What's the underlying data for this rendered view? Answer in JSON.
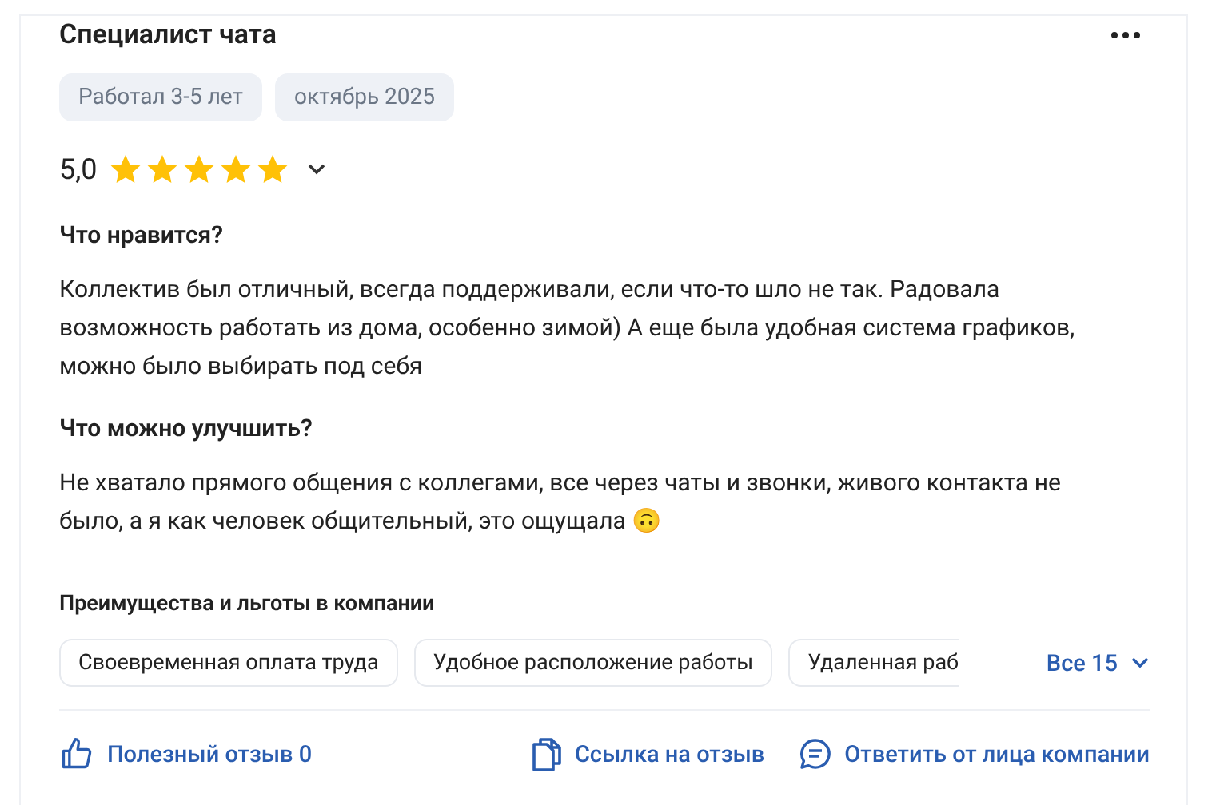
{
  "review": {
    "title": "Специалист чата",
    "tags": [
      "Работал 3-5 лет",
      "октябрь 2025"
    ],
    "rating": "5,0",
    "stars": 5,
    "sections": [
      {
        "heading": "Что нравится?",
        "text": "Коллектив был отличный, всегда поддерживали, если что-то шло не так. Радовала возможность работать из дома, особенно зимой) А еще была удобная система графиков, можно было выбирать под себя"
      },
      {
        "heading": "Что можно улучшить?",
        "text": "Не хватало прямого общения с коллегами, все через чаты и звонки, живого контакта не было, а я как человек общительный, это ощущала 🙃"
      }
    ],
    "benefits": {
      "title": "Преимущества и льготы в компании",
      "items": [
        "Своевременная оплата труда",
        "Удобное расположение работы",
        "Удаленная раб"
      ],
      "more": "Все 15"
    },
    "actions": {
      "helpful": "Полезный отзыв 0",
      "link": "Ссылка на отзыв",
      "reply": "Ответить от лица компании"
    }
  }
}
